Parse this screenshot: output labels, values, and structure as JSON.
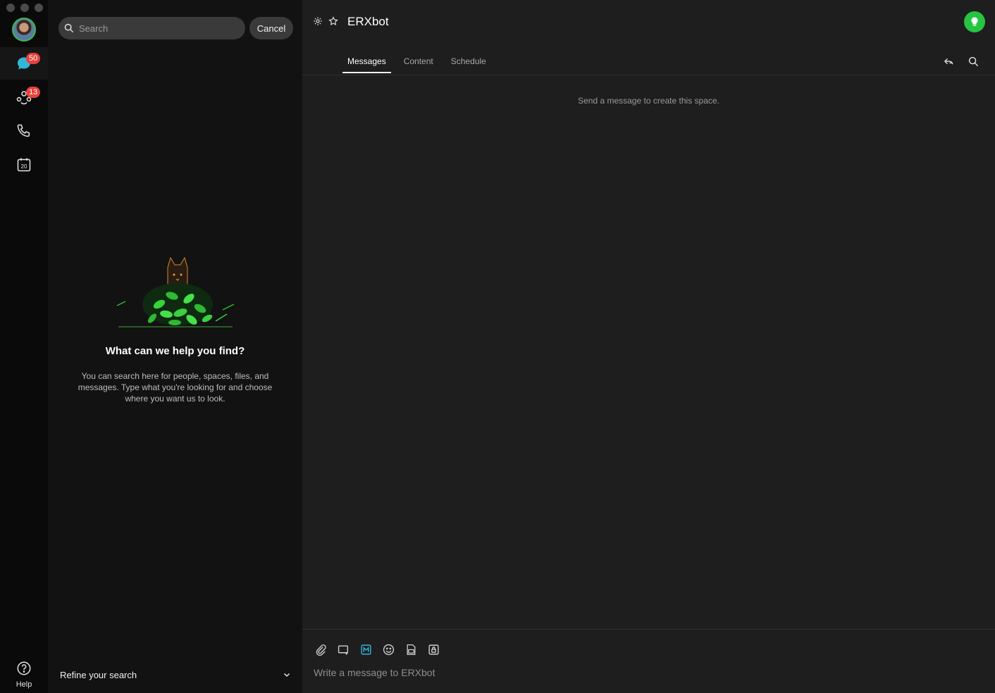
{
  "rail": {
    "badges": {
      "messaging": "50",
      "teams": "13"
    },
    "calendar_day": "20",
    "help_label": "Help"
  },
  "search": {
    "placeholder": "Search",
    "value": "",
    "cancel_label": "Cancel",
    "empty_title": "What can we help you find?",
    "empty_desc": "You can search here for people, spaces, files, and messages. Type what you're looking for and choose where you want us to look.",
    "refine_label": "Refine your search"
  },
  "space": {
    "title": "ERXbot",
    "tabs": [
      {
        "label": "Messages",
        "active": true
      },
      {
        "label": "Content",
        "active": false
      },
      {
        "label": "Schedule",
        "active": false
      }
    ],
    "empty_message": "Send a message to create this space.",
    "composer_placeholder": "Write a message to ERXbot"
  },
  "colors": {
    "status_green": "#27c442",
    "badge_red": "#e8403c",
    "accent_cyan": "#34b6d9"
  },
  "icons": [
    "search-icon",
    "chat-icon",
    "teams-icon",
    "phone-icon",
    "calendar-icon",
    "help-icon",
    "gear-icon",
    "star-icon",
    "chevron-down-icon",
    "attach-icon",
    "screenshot-icon",
    "markdown-icon",
    "emoji-icon",
    "gif-icon",
    "lock-icon",
    "reply-icon"
  ]
}
